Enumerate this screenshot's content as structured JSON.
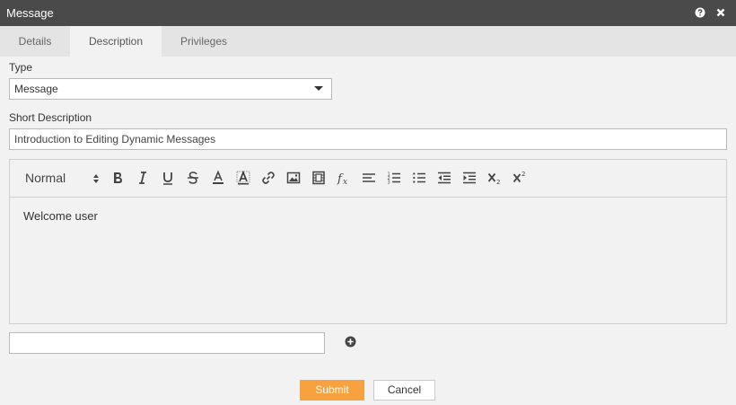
{
  "window": {
    "title": "Message"
  },
  "tabs": [
    {
      "label": "Details"
    },
    {
      "label": "Description"
    },
    {
      "label": "Privileges"
    }
  ],
  "form": {
    "type_label": "Type",
    "type_value": "Message",
    "short_desc_label": "Short Description",
    "short_desc_value": "Introduction to Editing Dynamic Messages",
    "extra_value": ""
  },
  "editor": {
    "format_value": "Normal",
    "content": "Welcome user",
    "toolbar_icons": [
      "bold-icon",
      "italic-icon",
      "underline-icon",
      "strikethrough-icon",
      "font-color-icon",
      "highlight-icon",
      "link-icon",
      "image-icon",
      "video-icon",
      "formula-icon",
      "align-icon",
      "ordered-list-icon",
      "bullet-list-icon",
      "outdent-icon",
      "indent-icon",
      "subscript-icon",
      "superscript-icon"
    ]
  },
  "buttons": {
    "submit": "Submit",
    "cancel": "Cancel"
  },
  "colors": {
    "titlebar": "#4a4a4a",
    "accent": "#f7a23e"
  }
}
